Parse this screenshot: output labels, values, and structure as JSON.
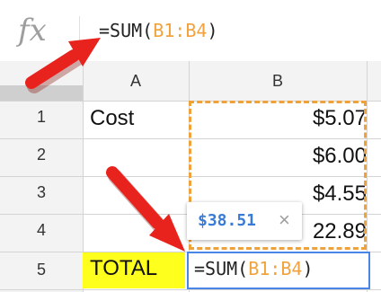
{
  "formula_bar": {
    "fx_label": "fx",
    "formula_prefix": "=SUM(",
    "formula_range": "B1:B4",
    "formula_suffix": ")"
  },
  "columns": [
    "A",
    "B"
  ],
  "rows": [
    {
      "num": "1",
      "a": "Cost",
      "b": "$5.07"
    },
    {
      "num": "2",
      "a": "",
      "b": "$6.00"
    },
    {
      "num": "3",
      "a": "",
      "b": "$4.55"
    },
    {
      "num": "4",
      "a": "",
      "b": "22.89"
    },
    {
      "num": "5",
      "a": "TOTAL",
      "b": ""
    }
  ],
  "active_cell": {
    "prefix": "=SUM(",
    "range": "B1:B4",
    "suffix": ")"
  },
  "tooltip": {
    "value": "$38.51",
    "close": "×"
  },
  "colors": {
    "range_highlight": "#f0a23a",
    "total_fill": "#ffff1e",
    "active_border": "#4a86e8",
    "arrow": "#e8221c"
  }
}
